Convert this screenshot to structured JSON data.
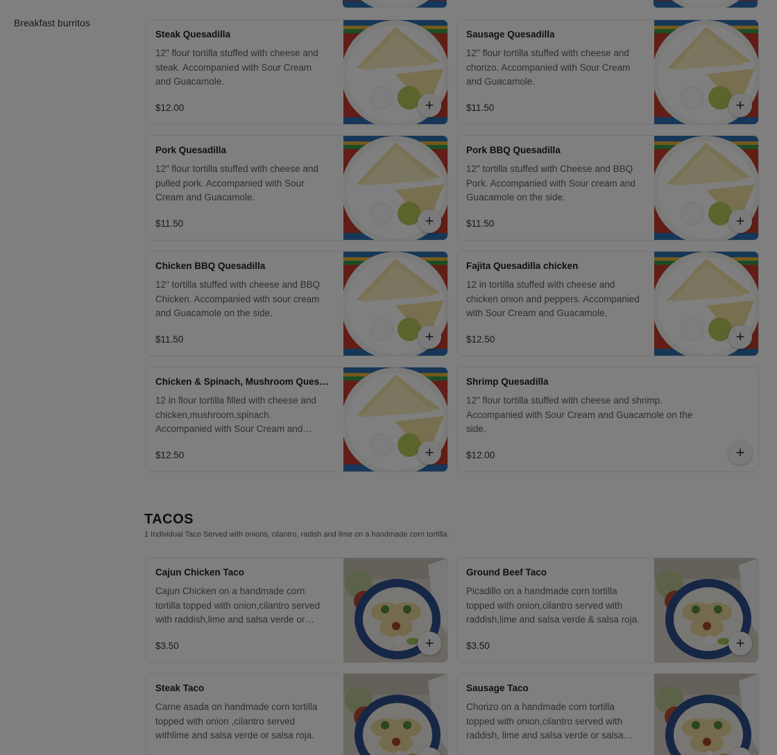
{
  "sidebar": {
    "items": [
      {
        "label": "Breakfast burritos"
      }
    ]
  },
  "quesadillas": {
    "items": [
      {
        "name": "Steak Quesadilla",
        "desc": "12\" flour tortilla stuffed with cheese and steak. Accompanied with Sour Cream and Guacamole.",
        "price": "$12.00",
        "image": "quesadilla-photo"
      },
      {
        "name": "Sausage Quesadilla",
        "desc": "12\" flour tortilla stuffed with cheese and chorizo. Accompanied with Sour Cream and Guacamole.",
        "price": "$11.50",
        "image": "quesadilla-photo"
      },
      {
        "name": "Pork Quesadilla",
        "desc": "12\" flour tortilla stuffed with cheese and pulled pork. Accompanied with Sour Cream and Guacamole.",
        "price": "$11.50",
        "image": "quesadilla-photo"
      },
      {
        "name": "Pork BBQ Quesadilla",
        "desc": "12\" tortilla stuffed with Cheese and BBQ Pork. Accompanied with Sour cream and Guacamole on the side.",
        "price": "$11.50",
        "image": "quesadilla-photo"
      },
      {
        "name": "Chicken BBQ Quesadilla",
        "desc": "12\" tortilla stuffed with cheese and BBQ Chicken. Accompanied with sour cream and Guacamole on the side.",
        "price": "$11.50",
        "image": "quesadilla-photo"
      },
      {
        "name": "Fajita Quesadilla chicken",
        "desc": "12 in tortilla stuffed with cheese and chicken onion and peppers. Accompanied with Sour Cream and Guacamole.",
        "price": "$12.50",
        "image": "quesadilla-photo"
      },
      {
        "name": "Chicken & Spinach, Mushroom Quesadilla",
        "desc": "12 in flour tortilla filled with cheese and chicken,mushroom,spinach. Accompanied with Sour Cream and Guacamole.",
        "price": "$12.50",
        "image": "quesadilla-photo"
      },
      {
        "name": "Shrimp Quesadilla",
        "desc": "12\" flour tortilla stuffed with cheese and shrimp. Accompanied with Sour Cream and Guacamole on the side.",
        "price": "$12.00",
        "image": null
      }
    ]
  },
  "tacos": {
    "title": "TACOS",
    "subtitle": "1 Individual Taco Served with onions, cilantro, radish and lime on a handmade corn tortilla.",
    "items": [
      {
        "name": "Cajun Chicken Taco",
        "desc": "Cajun Chicken on a handmade corn tortilla topped with onion,cilantro served with raddish,lime and salsa verde or salsa roja.",
        "price": "$3.50",
        "image": "taco-photo"
      },
      {
        "name": "Ground Beef Taco",
        "desc": "Picadillo on a handmade corn tortilla topped with onion,cilantro served with raddish,lime and salsa verde & salsa roja.",
        "price": "$3.50",
        "image": "taco-photo"
      },
      {
        "name": "Steak Taco",
        "desc": "Carne asada on handmade corn tortilla topped with onion ,cilantro served withlime and salsa verde or salsa roja.",
        "price": "",
        "image": "taco-photo"
      },
      {
        "name": "Sausage Taco",
        "desc": "Chorizo on a handmade corn tortilla topped with onion,cilantro served with raddish, lime and salsa verde or salsa roja.",
        "price": "",
        "image": "taco-photo"
      }
    ]
  },
  "colors": {
    "overlay": "#000000",
    "overlay_opacity": 0.5,
    "card_border": "#e6e6e6"
  },
  "icons": {
    "add": "plus-icon"
  }
}
